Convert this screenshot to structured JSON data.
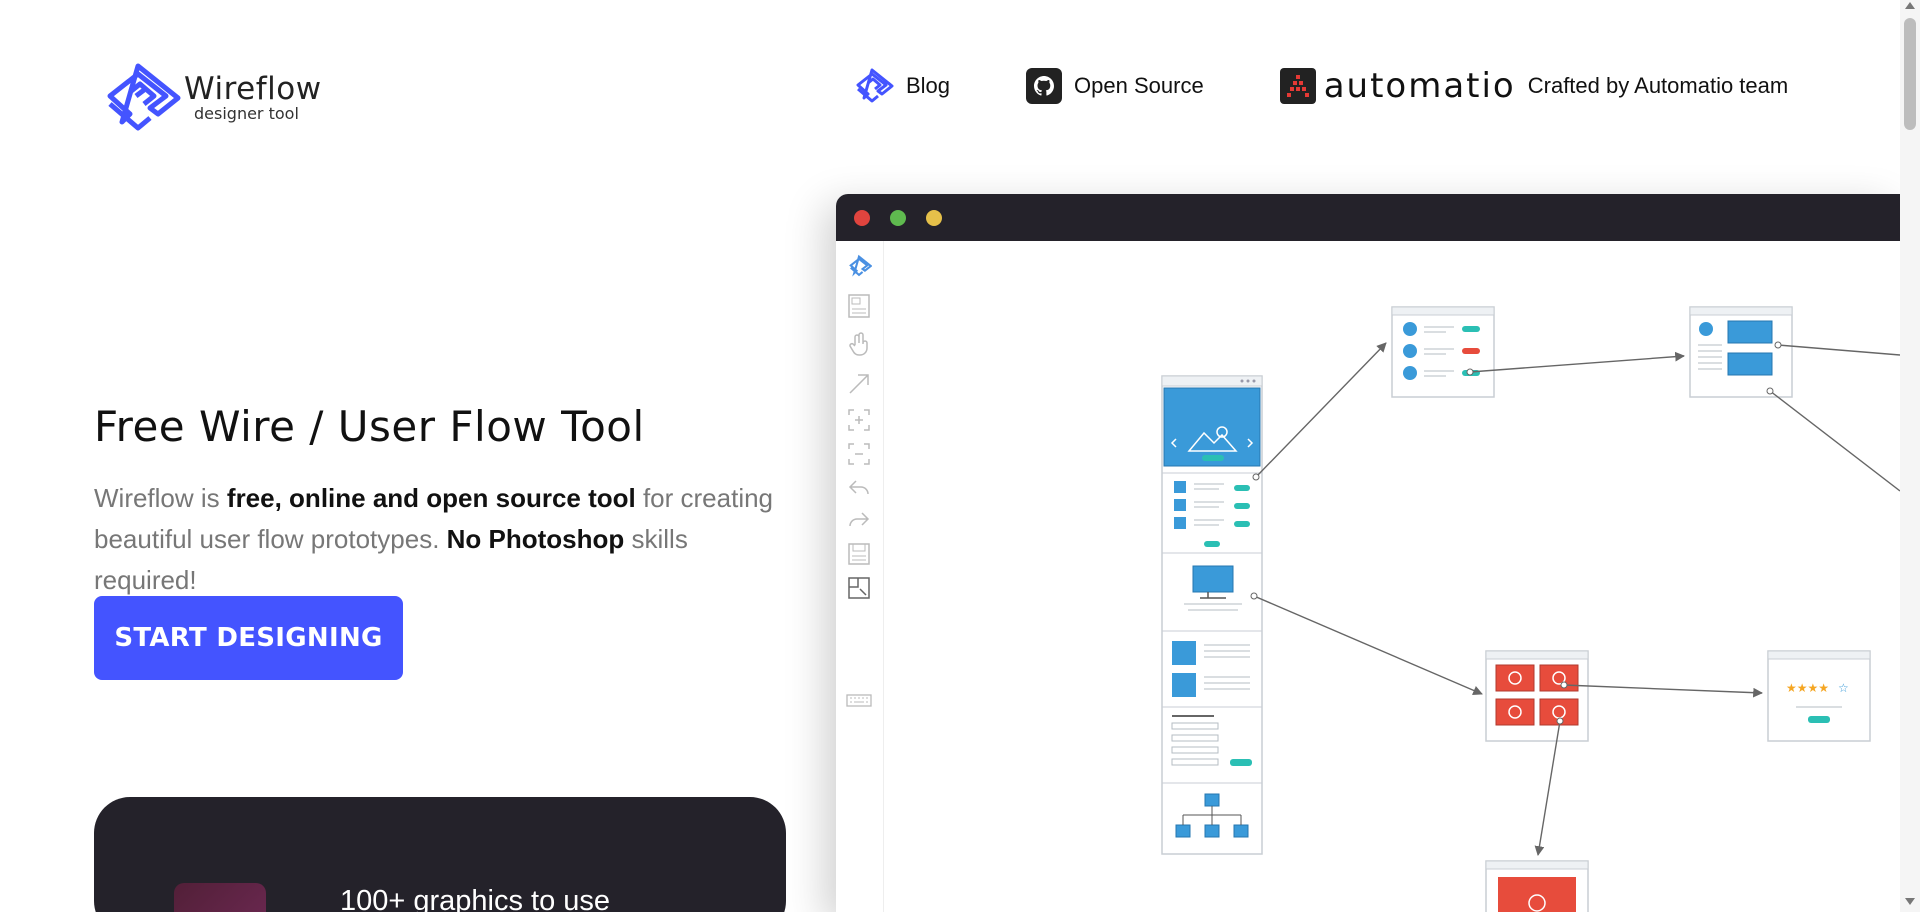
{
  "brand": {
    "name": "Wireflow",
    "tagline": "designer tool",
    "accent": "#4454ff",
    "dark": "#24222a"
  },
  "nav": {
    "blog_label": "Blog",
    "open_source_label": "Open Source",
    "automatio_word": "automatio",
    "crafted_label": "Crafted by Automatio team"
  },
  "hero": {
    "title": "Free Wire / User Flow Tool",
    "desc_1": "Wireflow is ",
    "desc_2": "free, online and open source tool",
    "desc_3": " for creating beautiful user flow prototypes. ",
    "desc_4": "No Photoshop",
    "desc_5": " skills required!",
    "cta_label": "START DESIGNING"
  },
  "feature_card": {
    "text": "100+ graphics to use"
  },
  "app_window": {
    "traffic_lights": [
      "#e0443e",
      "#5fba4f",
      "#e5c04a"
    ],
    "toolbar_icons": [
      "wireflow-logo-icon",
      "image-icon",
      "hand-icon",
      "arrow-icon",
      "zoom-in-icon",
      "zoom-out-icon",
      "undo-icon",
      "redo-icon",
      "save-icon",
      "export-icon",
      "keyboard-icon"
    ]
  }
}
